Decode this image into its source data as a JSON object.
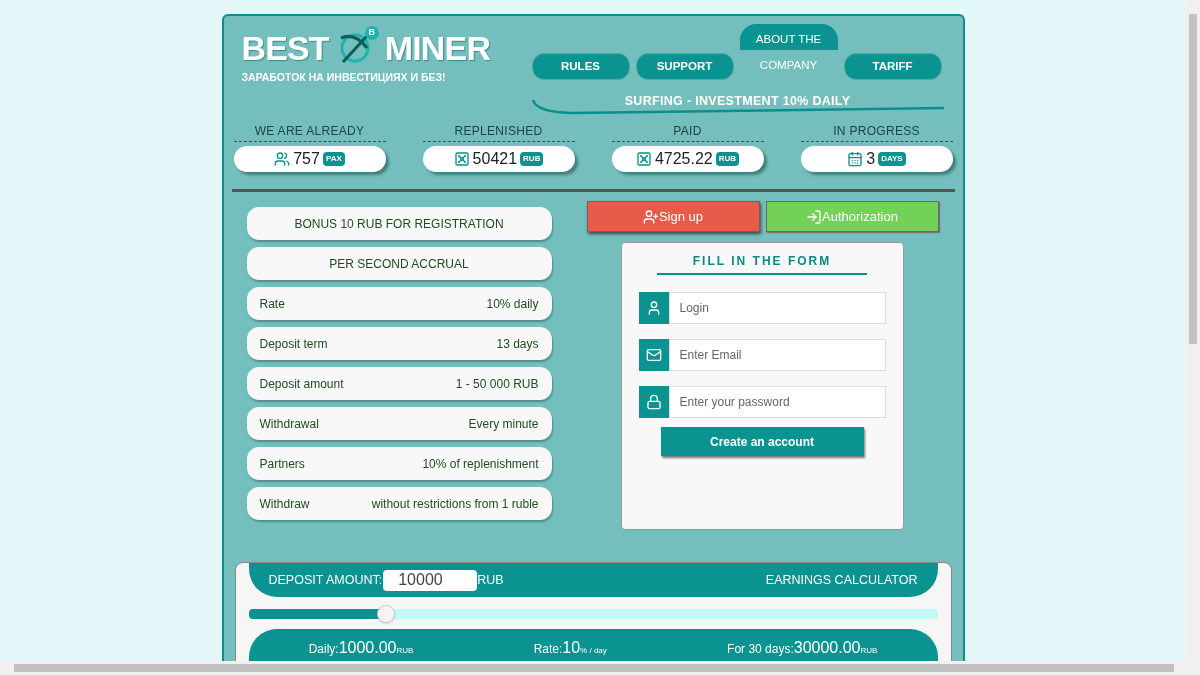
{
  "logo": {
    "word_1": "BEST",
    "badge": "B",
    "word_2": "MINER",
    "tagline": "ЗАРАБОТОК НА ИНВЕСТИЦИЯХ И БЕЗ!"
  },
  "nav": [
    {
      "label": "RULES",
      "selected": false
    },
    {
      "label": "SUPPORT",
      "selected": false
    },
    {
      "label": "ABOUT THE COMPANY",
      "selected": true
    },
    {
      "label": "TARIFF",
      "selected": false
    }
  ],
  "banner": "SURFING - INVESTMENT 10% DAILY",
  "stats": [
    {
      "label": "WE ARE ALREADY",
      "value": "757",
      "unit": "PAX",
      "kind": "people"
    },
    {
      "label": "REPLENISHED",
      "value": "50421",
      "unit": "RUB",
      "kind": "money"
    },
    {
      "label": "PAID",
      "value": "4725.22",
      "unit": "RUB",
      "kind": "money"
    },
    {
      "label": "IN PROGRESS",
      "value": "3",
      "unit": "DAYS",
      "kind": "calendar"
    }
  ],
  "info": {
    "headers": [
      "BONUS 10 RUB FOR REGISTRATION",
      "PER SECOND ACCRUAL"
    ],
    "rows": [
      {
        "label": "Rate",
        "value": "10% daily"
      },
      {
        "label": "Deposit term",
        "value": "13 days"
      },
      {
        "label": "Deposit amount",
        "value": "1 - 50 000 RUB"
      },
      {
        "label": "Withdrawal",
        "value": "Every minute"
      },
      {
        "label": "Partners",
        "value": "10% of replenishment"
      },
      {
        "label": "Withdraw",
        "value": "without restrictions from 1 ruble"
      }
    ]
  },
  "auth_buttons": [
    {
      "label": "Sign up",
      "kind": "signup",
      "selected": true
    },
    {
      "label": "Authorization",
      "kind": "login",
      "selected": false
    }
  ],
  "form": {
    "title": "FILL IN THE FORM",
    "fields": [
      {
        "placeholder": "Login",
        "kind": "user"
      },
      {
        "placeholder": "Enter Email",
        "kind": "email"
      },
      {
        "placeholder": "Enter your password",
        "kind": "lock"
      }
    ],
    "submit": "Create an account"
  },
  "calculator": {
    "label": "DEPOSIT AMOUNT:",
    "amount": "10000",
    "currency": "RUB",
    "title": "EARNINGS CALCULATOR",
    "slider": {
      "level": 0.2
    },
    "results": [
      {
        "label": "Daily:",
        "value": "1000.00",
        "unit": "RUB"
      },
      {
        "label": "Rate:",
        "value": "10",
        "unit": "% / day"
      },
      {
        "label": "For 30 days:",
        "value": "30000.00",
        "unit": "RUB"
      }
    ]
  }
}
